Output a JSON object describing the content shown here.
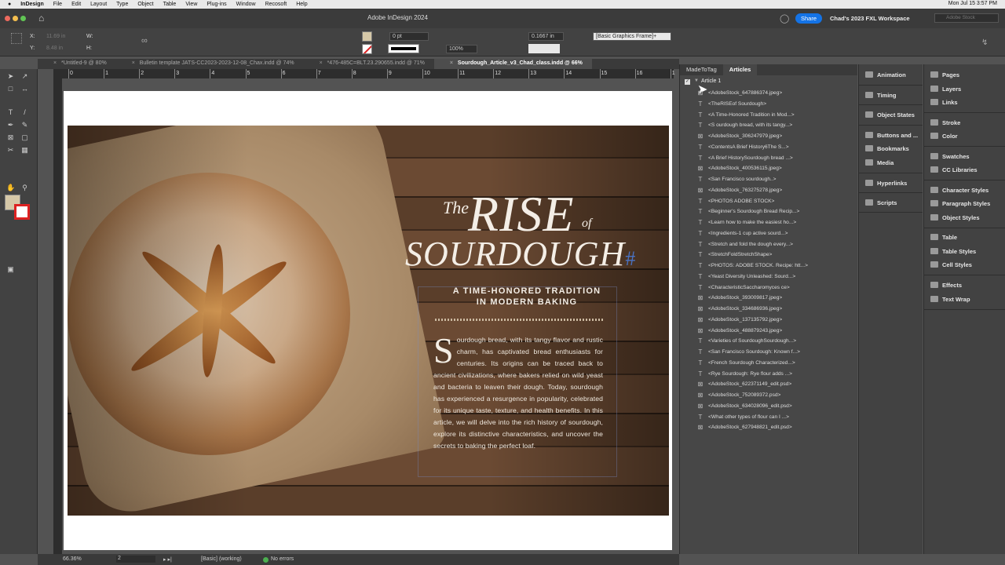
{
  "menubar": {
    "app": "InDesign",
    "items": [
      "File",
      "Edit",
      "Layout",
      "Type",
      "Object",
      "Table",
      "View",
      "Plug-ins",
      "Window",
      "Recosoft",
      "Help"
    ],
    "clock": "Mon Jul 15  3:57 PM"
  },
  "titlebar": {
    "title": "Adobe InDesign 2024",
    "share": "Share",
    "workspace": "Chad's 2023 FXL Workspace",
    "search_placeholder": "Adobe Stock"
  },
  "control": {
    "x_label": "X:",
    "y_label": "Y:",
    "w_label": "W:",
    "h_label": "H:",
    "x_value": "11.69 in",
    "y_value": "8.48 in",
    "stroke_weight": "0 pt",
    "scale": "100%",
    "spacing": "0.1667 in",
    "object_style": "[Basic Graphics Frame]+",
    "fill_color": "#d6c8a8"
  },
  "tabs": [
    {
      "label": "*Untitled-9 @ 80%"
    },
    {
      "label": "Bulletin template JATS-CC2023-2023-12-08_Chax.indd @ 74%"
    },
    {
      "label": "*476-485C=BLT.23.290655.indd @ 71%"
    },
    {
      "label": "Sourdough_Article_v3_Chad_class.indd @ 66%",
      "active": true
    }
  ],
  "ruler": [
    "0",
    "1",
    "2",
    "3",
    "4",
    "5",
    "6",
    "7",
    "8",
    "9",
    "10",
    "11",
    "12",
    "13",
    "14",
    "15",
    "16",
    "1"
  ],
  "document": {
    "the": "The",
    "rise": "RISE",
    "of": "of",
    "sourdough": "SOURDOUGH",
    "hash": "#",
    "subtitle1": "A TIME-HONORED TRADITION",
    "subtitle2": "IN MODERN BAKING",
    "dropcap": "S",
    "body": "ourdough bread, with its tangy flavor and rustic charm, has captivated bread enthusiasts for centuries. Its origins can be traced back to ancient civilizations, where bakers relied on wild yeast and bacteria to leaven their dough. Today, sourdough has experienced a resurgence in popularity, celebrated for its unique taste, texture, and health benefits. In this article, we will delve into the rich history of sourdough, explore its distinctive characteristics, and uncover the secrets to baking the perfect loaf."
  },
  "articles_panel": {
    "tabs": [
      "MadeToTag",
      "Articles"
    ],
    "article": "Article 1",
    "items": [
      {
        "type": "image",
        "label": "<AdobeStock_647886374.jpeg>"
      },
      {
        "type": "text",
        "label": "<TheRISEof Sourdough>"
      },
      {
        "type": "text",
        "label": "<A Time-Honored Tradition in Mod...>"
      },
      {
        "type": "text",
        "label": "<S ourdough bread, with its tangy...>"
      },
      {
        "type": "image",
        "label": "<AdobeStock_306247979.jpeg>"
      },
      {
        "type": "text",
        "label": "<ContentsA Brief History6The S...>"
      },
      {
        "type": "text",
        "label": "<A Brief HistorySourdough bread ...>"
      },
      {
        "type": "image",
        "label": "<AdobeStock_400536115.jpeg>"
      },
      {
        "type": "text",
        "label": "<San Francisco sourdough..>"
      },
      {
        "type": "image",
        "label": "<AdobeStock_763275278.jpeg>"
      },
      {
        "type": "text",
        "label": "<PHOTOS  ADOBE STOCK>"
      },
      {
        "type": "text",
        "label": "<Beginner's Sourdough Bread Recip...>"
      },
      {
        "type": "text",
        "label": "<Learn how to make the easiest ho...>"
      },
      {
        "type": "text",
        "label": "<Ingredients-1 cup active sourd...>"
      },
      {
        "type": "text",
        "label": "<Stretch and fold the dough every...>"
      },
      {
        "type": "text",
        "label": "<StretchFoldStretchShape>"
      },
      {
        "type": "text",
        "label": "<PHOTOS: ADOBE STOCK. Recipe: htt...>"
      },
      {
        "type": "text",
        "label": "<Yeast Diversity Unleashed: Sourd...>"
      },
      {
        "type": "text",
        "label": "<CharacteristicSaccharomyces ce>"
      },
      {
        "type": "image",
        "label": "<AdobeStock_393009817.jpeg>"
      },
      {
        "type": "image",
        "label": "<AdobeStock_334686936.jpeg>"
      },
      {
        "type": "image",
        "label": "<AdobeStock_137135792.jpeg>"
      },
      {
        "type": "image",
        "label": "<AdobeStock_488879243.jpeg>"
      },
      {
        "type": "text",
        "label": "<Varieties of SourdoughSourdough...>"
      },
      {
        "type": "text",
        "label": "<San Francisco Sourdough: Known f...>"
      },
      {
        "type": "text",
        "label": "<French Sourdough Characterized...>"
      },
      {
        "type": "text",
        "label": "<Rye Sourdough: Rye flour adds ...>"
      },
      {
        "type": "image",
        "label": "<AdobeStock_622371149_edit.psd>"
      },
      {
        "type": "image",
        "label": "<AdobeStock_752089372.psd>"
      },
      {
        "type": "image",
        "label": "<AdobeStock_634028096_edit.psd>"
      },
      {
        "type": "text",
        "label": "<What other types of flour can I ...>"
      },
      {
        "type": "image",
        "label": "<AdobeStock_627948821_edit.psd>"
      }
    ]
  },
  "panels_col1": [
    "Animation",
    "Timing",
    "Object States",
    "Buttons and ...",
    "Bookmarks",
    "Media",
    "Hyperlinks",
    "Scripts"
  ],
  "panels_col2": [
    "Pages",
    "Layers",
    "Links",
    "Stroke",
    "Color",
    "Swatches",
    "CC Libraries",
    "Character Styles",
    "Paragraph Styles",
    "Object Styles",
    "Table",
    "Table Styles",
    "Cell Styles",
    "Effects",
    "Text Wrap"
  ],
  "status": {
    "zoom": "66.36%",
    "page": "2",
    "preflight_profile": "[Basic] (working)",
    "errors": "No errors"
  }
}
